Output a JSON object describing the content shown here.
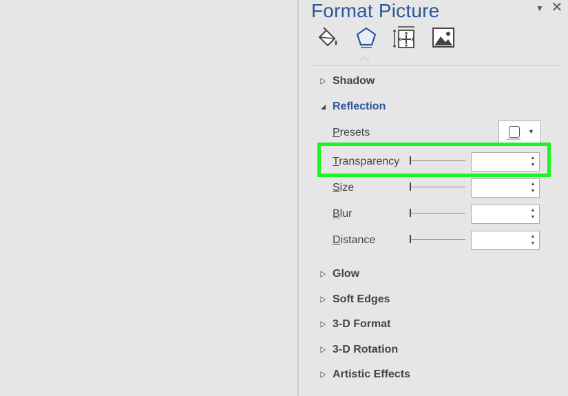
{
  "pane": {
    "title": "Format Picture",
    "menu_glyph": "▼",
    "close_glyph": "✕",
    "tabs": [
      {
        "name": "fill-line-icon"
      },
      {
        "name": "effects-icon",
        "active": true
      },
      {
        "name": "size-properties-icon"
      },
      {
        "name": "picture-icon"
      }
    ]
  },
  "sections": {
    "shadow": {
      "label": "Shadow",
      "expanded": false
    },
    "reflection": {
      "label": "Reflection",
      "expanded": true,
      "presets": {
        "label": "Presets",
        "access_key": "P",
        "rest": "resets"
      },
      "transparency": {
        "label": "Transparency",
        "access_key": "T",
        "rest": "ransparency",
        "value": "",
        "level": 0
      },
      "size": {
        "label": "Size",
        "access_key": "S",
        "rest": "ize",
        "value": "",
        "level": 0
      },
      "blur": {
        "label": "Blur",
        "access_key": "B",
        "rest": "lur",
        "value": "",
        "level": 0
      },
      "distance": {
        "label": "Distance",
        "access_key": "D",
        "rest": "istance",
        "value": "",
        "level": 0
      }
    },
    "glow": {
      "label": "Glow",
      "expanded": false
    },
    "soft_edges": {
      "label": "Soft Edges",
      "expanded": false
    },
    "three_d_format": {
      "label": "3-D Format",
      "expanded": false
    },
    "three_d_rotation": {
      "label": "3-D Rotation",
      "expanded": false
    },
    "artistic_effects": {
      "label": "Artistic Effects",
      "expanded": false
    }
  },
  "colors": {
    "accent": "#2b579a",
    "highlight": "#1ef31e",
    "pane_bg": "#e6e6e6"
  }
}
